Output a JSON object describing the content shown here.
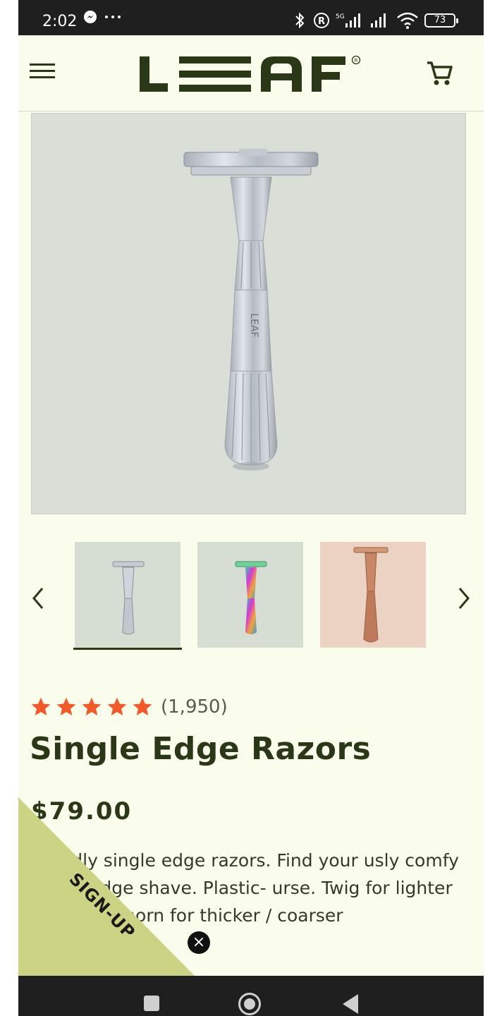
{
  "status_bar": {
    "time": "2:02",
    "battery": "73",
    "icons": [
      "messenger-icon",
      "more-dots-icon",
      "bluetooth-icon",
      "registered-icon",
      "signal-5g-icon",
      "signal-icon",
      "wifi-icon",
      "battery-icon"
    ]
  },
  "header": {
    "brand": "LEAF",
    "icons": [
      "hamburger-menu-icon",
      "cart-icon"
    ]
  },
  "product": {
    "review_count": "(1,950)",
    "stars": 5,
    "title": "Single Edge Razors",
    "price": "$79.00",
    "description": "friendly single edge razors. Find your usly comfy single-edge shave. Plastic- urse. Twig for lighter hair, s; a Thorn for thicker / coarser"
  },
  "gallery": {
    "thumbnails": [
      {
        "name": "silver-razor",
        "selected": true
      },
      {
        "name": "rainbow-razor",
        "selected": false
      },
      {
        "name": "rose-gold-razor",
        "selected": false
      }
    ]
  },
  "signup": {
    "label": "SIGN-UP",
    "close": "×"
  },
  "colors": {
    "background": "#fbfdec",
    "brand": "#2b3818",
    "star": "#f05a2a",
    "signup": "#cdd385"
  }
}
